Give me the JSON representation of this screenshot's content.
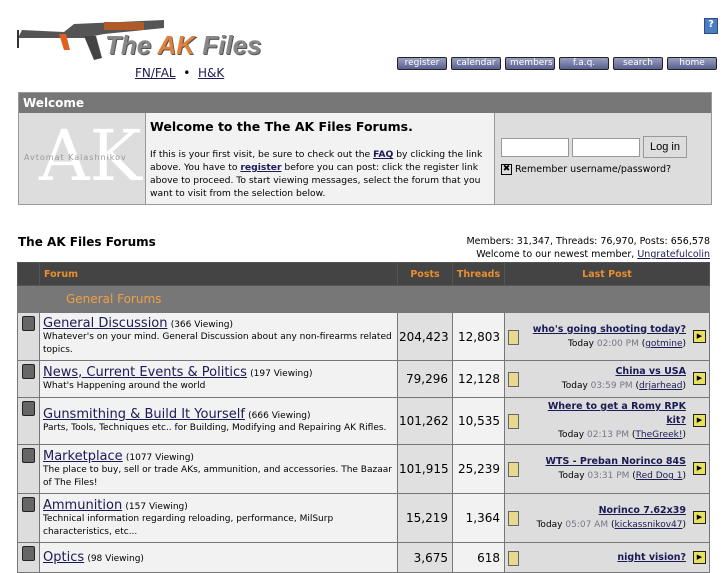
{
  "header": {
    "logo_text_1": "The ",
    "logo_text_ak": "AK",
    "logo_text_2": " Files",
    "links": [
      "FN/FAL",
      "H&K"
    ],
    "separator": "•",
    "help": "?",
    "nav": [
      "register",
      "calendar",
      "members",
      "f.a.q.",
      "search",
      "home"
    ]
  },
  "welcome": {
    "title": "Welcome",
    "logo_letters": "AK",
    "logo_caption": "Avtomat Kalashnikov",
    "heading": "Welcome to the The AK Files Forums.",
    "p1": "If this is your first visit, be sure to check out the ",
    "faq": "FAQ",
    "p2": " by clicking the link above. You have to ",
    "register": "register",
    "p3": " before you can post: click the register link above to proceed. To start viewing messages, select the forum that you want to visit from the selection below.",
    "username": "",
    "password": "",
    "login": "Log in",
    "remember": "Remember username/password?",
    "remember_mark": "✖"
  },
  "forums": {
    "title": "The AK Files Forums",
    "stats": "Members: 31,347, Threads: 76,970, Posts: 656,578",
    "newest_prefix": "Welcome to our newest member, ",
    "newest": "Ungratefulcolin",
    "columns": [
      "Forum",
      "Posts",
      "Threads",
      "Last Post"
    ],
    "category": "General Forums",
    "rows": [
      {
        "name": "General Discussion",
        "viewing": "(366 Viewing)",
        "desc": "Whatever's on your mind. General Discussion about any non-firearms related topics.",
        "posts": "204,423",
        "threads": "12,803",
        "lp_title": "who's going shooting today?",
        "lp_day": "Today",
        "lp_time": "02:00 PM",
        "lp_user": "gotmine"
      },
      {
        "name": "News, Current Events & Politics",
        "viewing": "(197 Viewing)",
        "desc": "What's Happening around the world",
        "posts": "79,296",
        "threads": "12,128",
        "lp_title": "China vs USA",
        "lp_day": "Today",
        "lp_time": "03:59 PM",
        "lp_user": "drjarhead"
      },
      {
        "name": "Gunsmithing & Build It Yourself",
        "viewing": "(666 Viewing)",
        "desc": "Parts, Tools, Techniques etc.. for Building, Modifying and Repairing AK Rifles.",
        "posts": "101,262",
        "threads": "10,535",
        "lp_title": "Where to get a Romy RPK kit?",
        "lp_day": "Today",
        "lp_time": "02:13 PM",
        "lp_user": "TheGreek!"
      },
      {
        "name": "Marketplace",
        "viewing": "(1077 Viewing)",
        "desc": "The place to buy, sell or trade AKs, ammunition, and accessories. The Bazaar of The Files!",
        "posts": "101,915",
        "threads": "25,239",
        "lp_title": "WTS - Preban Norinco 84S",
        "lp_day": "Today",
        "lp_time": "03:31 PM",
        "lp_user": "Red Dog 1"
      },
      {
        "name": "Ammunition",
        "viewing": "(157 Viewing)",
        "desc": "Technical information regarding reloading, performance, MilSurp characteristics, etc...",
        "posts": "15,219",
        "threads": "1,364",
        "lp_title": "Norinco 7.62x39",
        "lp_day": "Today",
        "lp_time": "05:07 AM",
        "lp_user": "kickassnikov47"
      },
      {
        "name": "Optics",
        "viewing": "(98 Viewing)",
        "desc": "",
        "posts": "3,675",
        "threads": "618",
        "lp_title": "night vision?",
        "lp_day": "",
        "lp_time": "",
        "lp_user": ""
      }
    ]
  }
}
